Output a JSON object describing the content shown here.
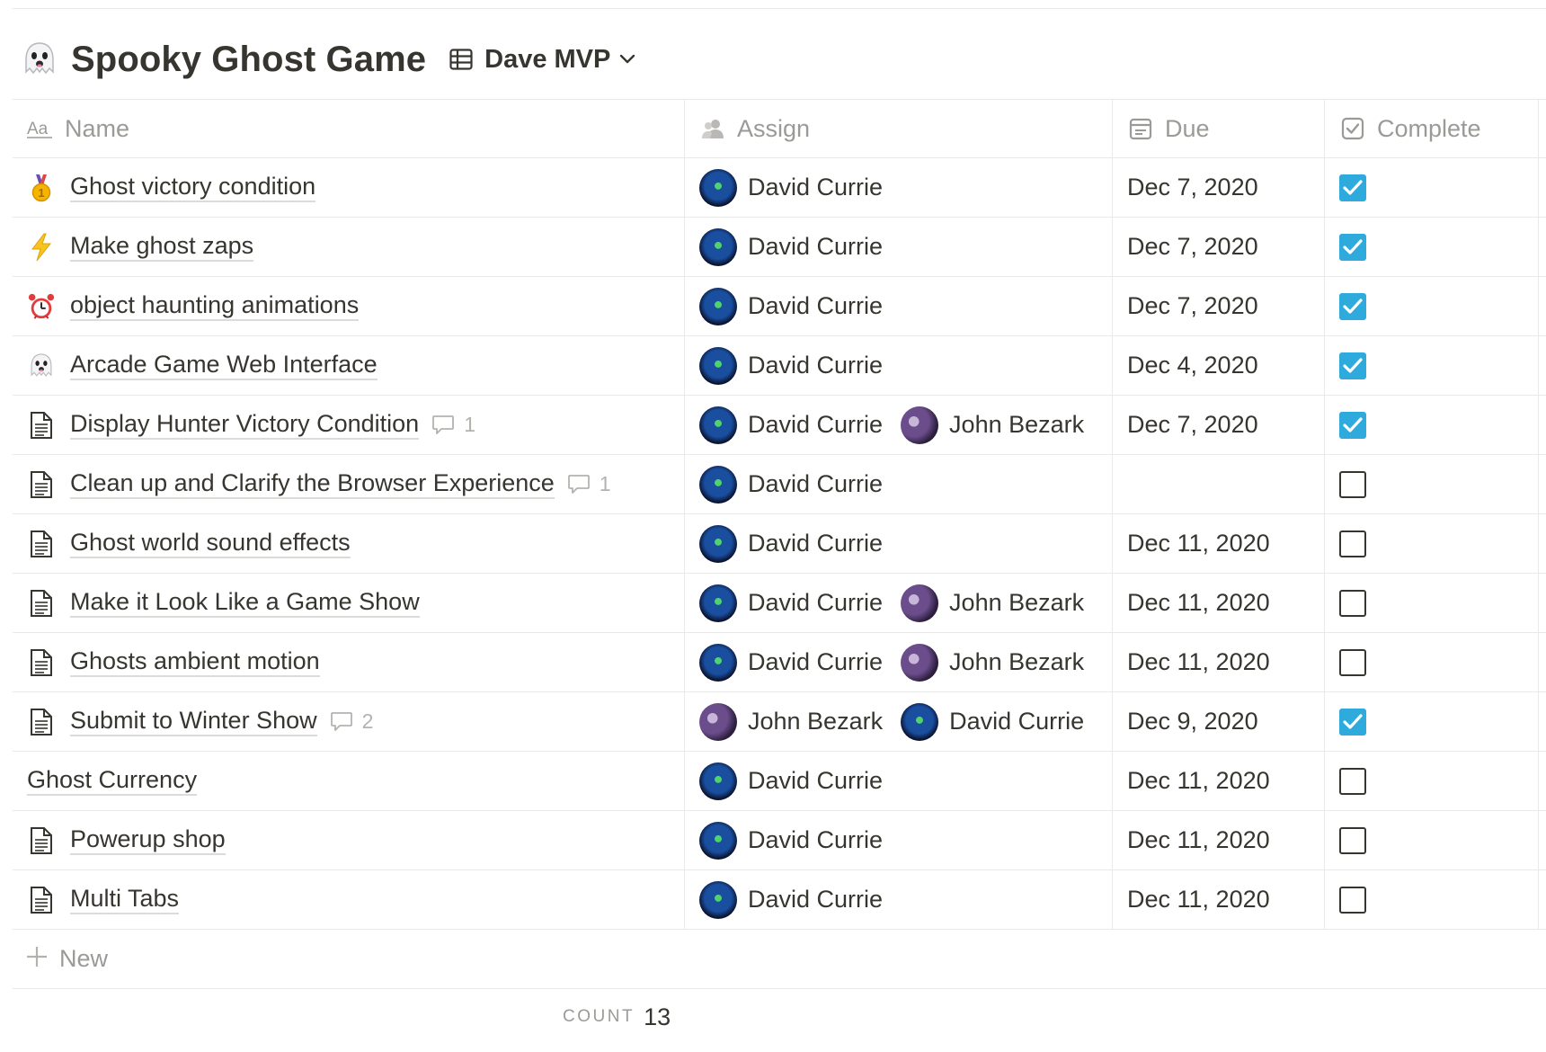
{
  "page": {
    "title": "Spooky Ghost Game",
    "title_icon": "ghost-emoji",
    "view_name": "Dave MVP"
  },
  "columns": {
    "name": "Name",
    "assign": "Assign",
    "due": "Due",
    "complete": "Complete"
  },
  "rows": [
    {
      "icon": "medal-icon",
      "title": "Ghost victory condition",
      "comments": "",
      "assignees": [
        "David Currie"
      ],
      "due": "Dec 7, 2020",
      "complete": true
    },
    {
      "icon": "lightning-icon",
      "title": "Make ghost zaps",
      "comments": "",
      "assignees": [
        "David Currie"
      ],
      "due": "Dec 7, 2020",
      "complete": true
    },
    {
      "icon": "alarm-clock-icon",
      "title": "object haunting animations",
      "comments": "",
      "assignees": [
        "David Currie"
      ],
      "due": "Dec 7, 2020",
      "complete": true
    },
    {
      "icon": "ghost-icon",
      "title": "Arcade Game Web Interface",
      "comments": "",
      "assignees": [
        "David Currie"
      ],
      "due": "Dec 4, 2020",
      "complete": true
    },
    {
      "icon": "page-icon",
      "title": "Display Hunter Victory Condition",
      "comments": "1",
      "assignees": [
        "David Currie",
        "John Bezark"
      ],
      "due": "Dec 7, 2020",
      "complete": true
    },
    {
      "icon": "page-icon",
      "title": "Clean up and Clarify the Browser Experience",
      "comments": "1",
      "assignees": [
        "David Currie"
      ],
      "due": "",
      "complete": false
    },
    {
      "icon": "page-icon",
      "title": "Ghost world sound effects",
      "comments": "",
      "assignees": [
        "David Currie"
      ],
      "due": "Dec 11, 2020",
      "complete": false
    },
    {
      "icon": "page-icon",
      "title": "Make it Look Like a Game Show",
      "comments": "",
      "assignees": [
        "David Currie",
        "John Bezark"
      ],
      "due": "Dec 11, 2020",
      "complete": false
    },
    {
      "icon": "page-icon",
      "title": "Ghosts ambient motion",
      "comments": "",
      "assignees": [
        "David Currie",
        "John Bezark"
      ],
      "due": "Dec 11, 2020",
      "complete": false
    },
    {
      "icon": "page-icon",
      "title": "Submit to Winter Show",
      "comments": "2",
      "assignees": [
        "John Bezark",
        "David Currie"
      ],
      "due": "Dec 9, 2020",
      "complete": true
    },
    {
      "icon": "",
      "title": "Ghost Currency",
      "comments": "",
      "assignees": [
        "David Currie"
      ],
      "due": "Dec 11, 2020",
      "complete": false
    },
    {
      "icon": "page-icon",
      "title": "Powerup shop",
      "comments": "",
      "assignees": [
        "David Currie"
      ],
      "due": "Dec 11, 2020",
      "complete": false
    },
    {
      "icon": "page-icon",
      "title": "Multi Tabs",
      "comments": "",
      "assignees": [
        "David Currie"
      ],
      "due": "Dec 11, 2020",
      "complete": false
    }
  ],
  "footer": {
    "new_label": "New",
    "count_label": "COUNT",
    "count_value": "13"
  },
  "colors": {
    "checkbox_on": "#2eaadc",
    "text": "#37352f",
    "muted": "#9b9a97",
    "border": "#e9e9e7"
  }
}
